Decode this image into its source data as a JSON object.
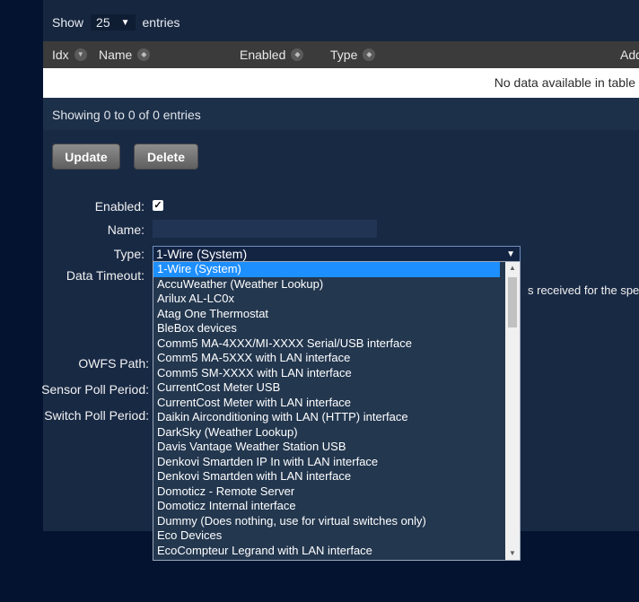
{
  "length_menu": {
    "prefix": "Show",
    "value": "25",
    "suffix": "entries"
  },
  "table": {
    "columns": [
      "Idx",
      "Name",
      "Enabled",
      "Type",
      "Add"
    ],
    "empty_message": "No data available in table",
    "info": "Showing 0 to 0 of 0 entries"
  },
  "buttons": {
    "update": "Update",
    "delete": "Delete"
  },
  "form": {
    "enabled_label": "Enabled:",
    "enabled_checked": true,
    "name_label": "Name:",
    "name_value": "",
    "type_label": "Type:",
    "type_value": "1-Wire (System)",
    "data_timeout_label": "Data Timeout:",
    "timeout_hint": "s received for the spec",
    "owfs_label": "OWFS Path:",
    "sensor_poll_label": "Sensor Poll Period:",
    "switch_poll_label": "Switch Poll Period:"
  },
  "dropdown": {
    "options": [
      "1-Wire (System)",
      "AccuWeather (Weather Lookup)",
      "Arilux AL-LC0x",
      "Atag One Thermostat",
      "BleBox devices",
      "Comm5 MA-4XXX/MI-XXXX Serial/USB interface",
      "Comm5 MA-5XXX with LAN interface",
      "Comm5 SM-XXXX with LAN interface",
      "CurrentCost Meter USB",
      "CurrentCost Meter with LAN interface",
      "Daikin Airconditioning with LAN (HTTP) interface",
      "DarkSky (Weather Lookup)",
      "Davis Vantage Weather Station USB",
      "Denkovi Smartden IP In with LAN interface",
      "Denkovi Smartden with LAN interface",
      "Domoticz - Remote Server",
      "Domoticz Internal interface",
      "Dummy (Does nothing, use for virtual switches only)",
      "Eco Devices",
      "EcoCompteur Legrand with LAN interface"
    ]
  },
  "icons": {
    "select_arrow": "▼",
    "sort": "sort-icon",
    "scroll_up": "▲",
    "scroll_down": "▼"
  }
}
